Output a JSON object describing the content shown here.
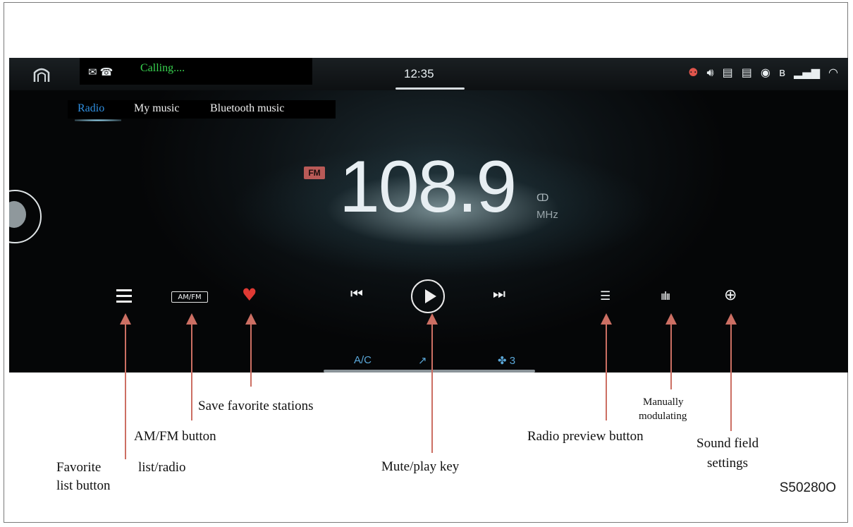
{
  "status_bar": {
    "notification_icons": [
      "mail-icon",
      "missed-call-icon"
    ],
    "calling_text": "Calling....",
    "time": "12:35",
    "right_icons": [
      "person-icon",
      "volume-icon",
      "usb-icon",
      "usb-icon",
      "hotspot-icon",
      "bluetooth-icon",
      "signal-icon",
      "wifi-icon"
    ]
  },
  "tabs": [
    {
      "label": "Radio",
      "active": true
    },
    {
      "label": "My music",
      "active": false
    },
    {
      "label": "Bluetooth music",
      "active": false
    }
  ],
  "radio": {
    "band_badge": "FM",
    "frequency": "108.9",
    "stereo_symbol": "ↀ",
    "unit": "MHz"
  },
  "controls": {
    "amfm_label": "AM/FM",
    "heart_color": "#e03a34"
  },
  "climate": {
    "ac_label": "A/C",
    "fan_label": "3"
  },
  "annotations": {
    "save_favorite": "Save favorite stations",
    "amfm_button": "AM/FM button",
    "favorite_list": [
      "Favorite",
      "list button"
    ],
    "list_radio": "list/radio",
    "mute_play": "Mute/play key",
    "radio_preview": "Radio preview button",
    "manually": [
      "Manually",
      "modulating"
    ],
    "sound_field": [
      "Sound field",
      "settings"
    ]
  },
  "figure_code": "S50280O",
  "colors": {
    "accent_blue": "#2f8fe0",
    "calling_green": "#38d24f",
    "arrow_red": "#cc6f63"
  }
}
